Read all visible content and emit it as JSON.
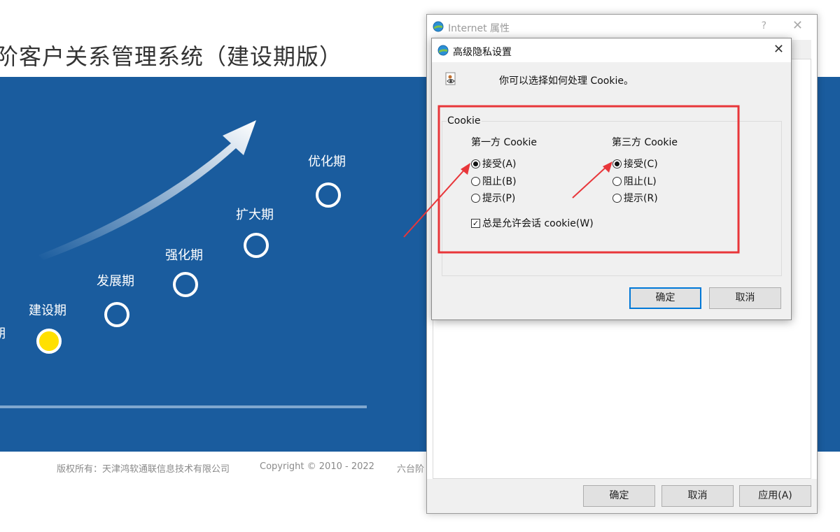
{
  "page": {
    "title": "阶客户关系管理系统（建设期版）",
    "stages": [
      "期",
      "建设期",
      "发展期",
      "强化期",
      "扩大期",
      "优化期"
    ],
    "footer": {
      "copyright_owner": "版权所有：天津鸿软通联信息技术有限公司",
      "copyright_years": "Copyright © 2010 - 2022",
      "product": "六台阶"
    }
  },
  "internet_options": {
    "title": "Internet 属性",
    "help": "?",
    "close": "✕",
    "buttons": {
      "ok": "确定",
      "cancel": "取消",
      "apply": "应用(A)"
    }
  },
  "privacy_dialog": {
    "title": "高级隐私设置",
    "close": "✕",
    "description": "你可以选择如何处理 Cookie。",
    "group_label": "Cookie",
    "first_party": {
      "heading": "第一方 Cookie",
      "options": [
        "接受(A)",
        "阻止(B)",
        "提示(P)"
      ],
      "selected": "接受(A)"
    },
    "third_party": {
      "heading": "第三方 Cookie",
      "options": [
        "接受(C)",
        "阻止(L)",
        "提示(R)"
      ],
      "selected": "接受(C)"
    },
    "session_cookie": {
      "label": "总是允许会话 cookie(W)",
      "checked": true,
      "mark": "✓"
    },
    "buttons": {
      "ok": "确定",
      "cancel": "取消"
    }
  },
  "colors": {
    "banner": "#1a5c9e",
    "highlight_box": "#e8363a",
    "active_stage": "#ffe000",
    "default_button_border": "#0078d7"
  },
  "icons": {
    "window_icon": "ie-globe-icon",
    "privacy_icon": "privacy-eye-icon",
    "growth_arrow": "growth-arrow-icon"
  }
}
